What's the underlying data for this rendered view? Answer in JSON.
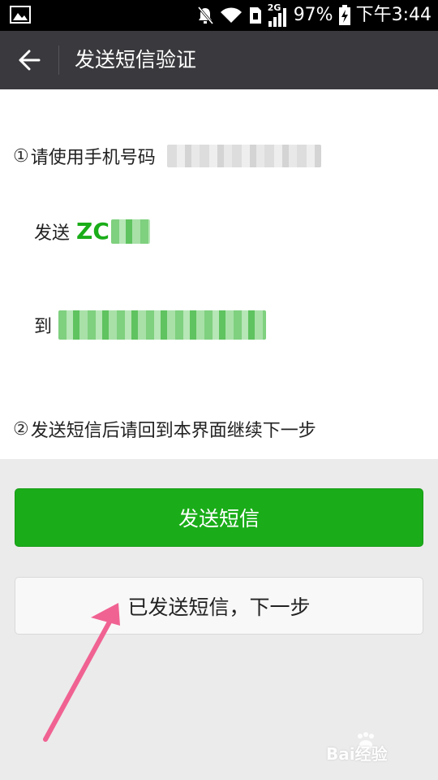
{
  "status_bar": {
    "battery": "97%",
    "time": "下午3:44",
    "network": "2G",
    "icons": [
      "gallery-icon",
      "mute-icon",
      "wifi-icon",
      "sim-icon",
      "signal-icon",
      "battery-icon"
    ]
  },
  "header": {
    "back_icon": "back-arrow-icon",
    "title": "发送短信验证"
  },
  "steps": {
    "step1": {
      "num": "①",
      "text": "请使用手机号码",
      "send_label": "发送",
      "code_visible": "ZC",
      "to_label": "到"
    },
    "step2": {
      "num": "②",
      "text": "发送短信后请回到本界面继续下一步"
    }
  },
  "buttons": {
    "send_sms": "发送短信",
    "sent_next": "已发送短信，下一步"
  },
  "colors": {
    "accent": "#1aad19",
    "header_bg": "#3a3a3e",
    "annotation": "#f06292"
  },
  "watermark": {
    "icon": "baidu-paw-icon",
    "text": "Bai经验"
  }
}
